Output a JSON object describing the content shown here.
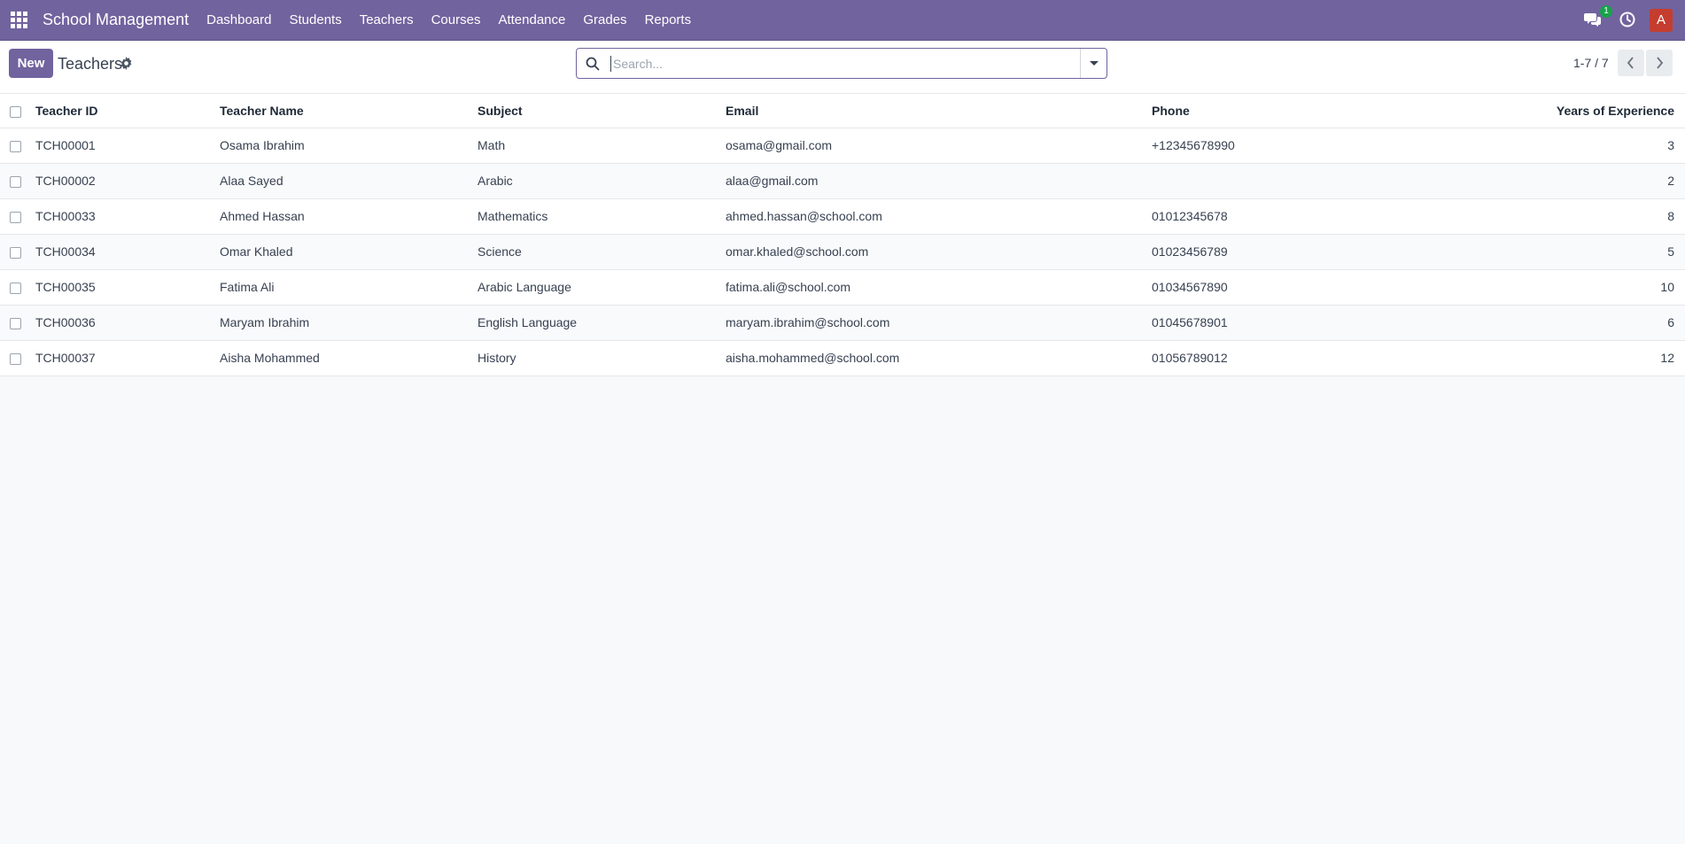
{
  "navbar": {
    "brand": "School Management",
    "menu": [
      "Dashboard",
      "Students",
      "Teachers",
      "Courses",
      "Attendance",
      "Grades",
      "Reports"
    ],
    "chat_badge": "1",
    "avatar_letter": "A",
    "color": "#71639e"
  },
  "control_panel": {
    "new_label": "New",
    "title": "Teachers",
    "search_placeholder": "Search...",
    "pager": "1-7 / 7"
  },
  "table": {
    "columns": [
      "Teacher ID",
      "Teacher Name",
      "Subject",
      "Email",
      "Phone",
      "Years of Experience"
    ],
    "rows": [
      {
        "id": "TCH00001",
        "name": "Osama Ibrahim",
        "subject": "Math",
        "email": "osama@gmail.com",
        "phone": "+12345678990",
        "years": "3"
      },
      {
        "id": "TCH00002",
        "name": "Alaa Sayed",
        "subject": "Arabic",
        "email": "alaa@gmail.com",
        "phone": "",
        "years": "2"
      },
      {
        "id": "TCH00033",
        "name": "Ahmed Hassan",
        "subject": "Mathematics",
        "email": "ahmed.hassan@school.com",
        "phone": "01012345678",
        "years": "8"
      },
      {
        "id": "TCH00034",
        "name": "Omar Khaled",
        "subject": "Science",
        "email": "omar.khaled@school.com",
        "phone": "01023456789",
        "years": "5"
      },
      {
        "id": "TCH00035",
        "name": "Fatima Ali",
        "subject": "Arabic Language",
        "email": "fatima.ali@school.com",
        "phone": "01034567890",
        "years": "10"
      },
      {
        "id": "TCH00036",
        "name": "Maryam Ibrahim",
        "subject": "English Language",
        "email": "maryam.ibrahim@school.com",
        "phone": "01045678901",
        "years": "6"
      },
      {
        "id": "TCH00037",
        "name": "Aisha Mohammed",
        "subject": "History",
        "email": "aisha.mohammed@school.com",
        "phone": "01056789012",
        "years": "12"
      }
    ]
  }
}
